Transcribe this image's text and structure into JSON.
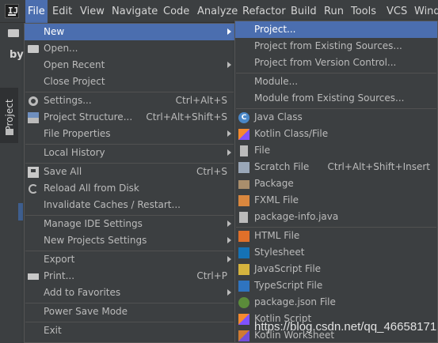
{
  "menubar": {
    "items": [
      "File",
      "Edit",
      "View",
      "Navigate",
      "Code",
      "Analyze",
      "Refactor",
      "Build",
      "Run",
      "Tools",
      "VCS",
      "Wind"
    ]
  },
  "background": {
    "crumb": "bys",
    "project_tab": "Project"
  },
  "file_menu": {
    "items": [
      {
        "label": "New",
        "shortcut": "",
        "submenu": true
      },
      {
        "label": "Open...",
        "shortcut": "",
        "submenu": false
      },
      {
        "label": "Open Recent",
        "shortcut": "",
        "submenu": true
      },
      {
        "label": "Close Project",
        "shortcut": "",
        "submenu": false
      },
      {
        "label": "Settings...",
        "shortcut": "Ctrl+Alt+S",
        "submenu": false
      },
      {
        "label": "Project Structure...",
        "shortcut": "Ctrl+Alt+Shift+S",
        "submenu": false
      },
      {
        "label": "File Properties",
        "shortcut": "",
        "submenu": true
      },
      {
        "label": "Local History",
        "shortcut": "",
        "submenu": true
      },
      {
        "label": "Save All",
        "shortcut": "Ctrl+S",
        "submenu": false
      },
      {
        "label": "Reload All from Disk",
        "shortcut": "",
        "submenu": false
      },
      {
        "label": "Invalidate Caches / Restart...",
        "shortcut": "",
        "submenu": false
      },
      {
        "label": "Manage IDE Settings",
        "shortcut": "",
        "submenu": true
      },
      {
        "label": "New Projects Settings",
        "shortcut": "",
        "submenu": true
      },
      {
        "label": "Export",
        "shortcut": "",
        "submenu": true
      },
      {
        "label": "Print...",
        "shortcut": "Ctrl+P",
        "submenu": false
      },
      {
        "label": "Add to Favorites",
        "shortcut": "",
        "submenu": true
      },
      {
        "label": "Power Save Mode",
        "shortcut": "",
        "submenu": false
      },
      {
        "label": "Exit",
        "shortcut": "",
        "submenu": false
      }
    ]
  },
  "new_submenu": {
    "items": [
      {
        "label": "Project...",
        "shortcut": "",
        "icon": ""
      },
      {
        "label": "Project from Existing Sources...",
        "shortcut": "",
        "icon": ""
      },
      {
        "label": "Project from Version Control...",
        "shortcut": "",
        "icon": ""
      },
      {
        "label": "Module...",
        "shortcut": "",
        "icon": ""
      },
      {
        "label": "Module from Existing Sources...",
        "shortcut": "",
        "icon": ""
      },
      {
        "label": "Java Class",
        "shortcut": "",
        "icon": "java-class-icon"
      },
      {
        "label": "Kotlin Class/File",
        "shortcut": "",
        "icon": "kotlin-icon"
      },
      {
        "label": "File",
        "shortcut": "",
        "icon": "file-icon"
      },
      {
        "label": "Scratch File",
        "shortcut": "Ctrl+Alt+Shift+Insert",
        "icon": "scratch-file-icon"
      },
      {
        "label": "Package",
        "shortcut": "",
        "icon": "package-icon"
      },
      {
        "label": "FXML File",
        "shortcut": "",
        "icon": "fxml-icon"
      },
      {
        "label": "package-info.java",
        "shortcut": "",
        "icon": "package-info-icon"
      },
      {
        "label": "HTML File",
        "shortcut": "",
        "icon": "html-icon"
      },
      {
        "label": "Stylesheet",
        "shortcut": "",
        "icon": "css-icon"
      },
      {
        "label": "JavaScript File",
        "shortcut": "",
        "icon": "javascript-icon"
      },
      {
        "label": "TypeScript File",
        "shortcut": "",
        "icon": "typescript-icon"
      },
      {
        "label": "package.json File",
        "shortcut": "",
        "icon": "nodejs-icon"
      },
      {
        "label": "Kotlin Script",
        "shortcut": "",
        "icon": "kotlin-script-icon"
      },
      {
        "label": "Kotlin Worksheet",
        "shortcut": "",
        "icon": "kotlin-worksheet-icon"
      }
    ]
  },
  "watermark": "https://blog.csdn.net/qq_46658171",
  "colors": {
    "selection": "#4b6eaf",
    "menu_bg": "#3c3f41",
    "text": "#bbbbbb"
  }
}
